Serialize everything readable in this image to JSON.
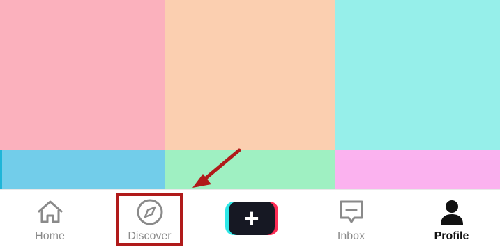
{
  "feed": {
    "tiles": [
      {
        "color": "#fbb1bd"
      },
      {
        "color": "#fbcfb0"
      },
      {
        "color": "#96efea"
      },
      {
        "color": "#72cdea"
      },
      {
        "color": "#9ff0c2"
      },
      {
        "color": "#fbb2ef"
      }
    ]
  },
  "tabbar": {
    "tabs": [
      {
        "label": "Home",
        "icon": "home-icon",
        "active": false
      },
      {
        "label": "Discover",
        "icon": "compass-icon",
        "active": false
      },
      {
        "label": "",
        "icon": "plus-icon",
        "active": false
      },
      {
        "label": "Inbox",
        "icon": "inbox-icon",
        "active": false
      },
      {
        "label": "Profile",
        "icon": "profile-icon",
        "active": true
      }
    ],
    "create_symbol": "+"
  },
  "annotation": {
    "highlight_target": "Discover",
    "color": "#b01a1a"
  },
  "colors": {
    "create_cyan": "#2ee7e7",
    "create_pink": "#fe2c55",
    "create_core": "#161823",
    "inactive": "#8a8a8a",
    "active": "#111111"
  }
}
